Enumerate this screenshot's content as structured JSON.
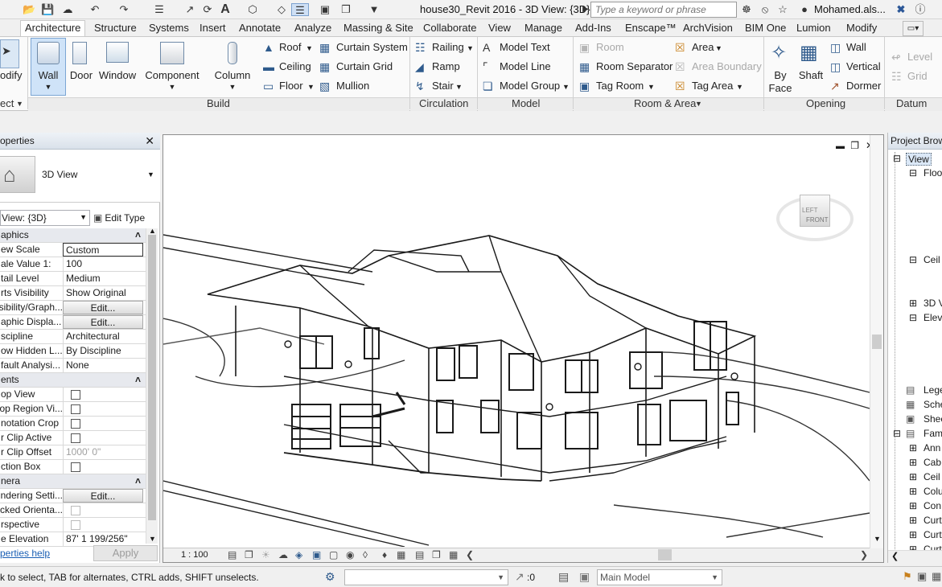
{
  "window": {
    "title": "house30_Revit 2016 - 3D View: {3D}"
  },
  "search": {
    "placeholder": "Type a keyword or phrase"
  },
  "user": {
    "name": "Mohamed.als..."
  },
  "tabs": [
    "Architecture",
    "Structure",
    "Systems",
    "Insert",
    "Annotate",
    "Analyze",
    "Massing & Site",
    "Collaborate",
    "View",
    "Manage",
    "Add-Ins",
    "Enscape™",
    "ArchVision",
    "BIM One",
    "Lumion",
    "Modify"
  ],
  "ribbon": {
    "modify": "odify",
    "select": "ect",
    "build": {
      "wall": "Wall",
      "door": "Door",
      "window": "Window",
      "component": "Component",
      "column": "Column",
      "roof": "Roof",
      "ceiling": "Ceiling",
      "floor": "Floor",
      "curtain_system": "Curtain System",
      "curtain_grid": "Curtain  Grid",
      "mullion": "Mullion",
      "panel": "Build"
    },
    "circulation": {
      "railing": "Railing",
      "ramp": "Ramp",
      "stair": "Stair",
      "panel": "Circulation"
    },
    "model": {
      "text": "Model  Text",
      "line": "Model  Line",
      "group": "Model  Group",
      "panel": "Model"
    },
    "room": {
      "room": "Room",
      "separator": "Room  Separator",
      "tag_room": "Tag  Room",
      "area": "Area",
      "area_boundary": "Area  Boundary",
      "tag_area": "Tag  Area",
      "panel": "Room & Area"
    },
    "opening": {
      "by_face": "By\nFace",
      "shaft": "Shaft",
      "wall": "Wall",
      "vertical": "Vertical",
      "dormer": "Dormer",
      "panel": "Opening"
    },
    "datum": {
      "level": "Level",
      "grid": "Grid",
      "panel": "Datum"
    }
  },
  "properties": {
    "title": "operties",
    "type_name": "3D View",
    "selector": "View: {3D}",
    "edit_type": "Edit Type",
    "rows": [
      {
        "k": "aphics",
        "group": true
      },
      {
        "k": "ew Scale",
        "v": "Custom",
        "style": "box"
      },
      {
        "k": "ale Value   1:",
        "v": "100"
      },
      {
        "k": "tail Level",
        "v": "Medium"
      },
      {
        "k": "rts Visibility",
        "v": "Show Original"
      },
      {
        "k": "sibility/Graph...",
        "v": "Edit...",
        "style": "btn"
      },
      {
        "k": "aphic Displa...",
        "v": "Edit...",
        "style": "btn"
      },
      {
        "k": "scipline",
        "v": "Architectural"
      },
      {
        "k": "ow Hidden L...",
        "v": "By Discipline"
      },
      {
        "k": "fault Analysi...",
        "v": "None"
      },
      {
        "k": "ents",
        "group": true
      },
      {
        "k": "op View",
        "cb": true
      },
      {
        "k": "op Region Vi...",
        "cb": true
      },
      {
        "k": "notation Crop",
        "cb": true
      },
      {
        "k": "r Clip Active",
        "cb": true
      },
      {
        "k": "r Clip Offset",
        "v": "1000'  0\"",
        "style": "dis"
      },
      {
        "k": "ction Box",
        "cb": true
      },
      {
        "k": "nera",
        "group": true
      },
      {
        "k": "ndering Setti...",
        "v": "Edit...",
        "style": "btn"
      },
      {
        "k": "cked Orienta...",
        "cb": true,
        "dis": true
      },
      {
        "k": "rspective",
        "cb": true,
        "dis": true
      },
      {
        "k": "e Elevation",
        "v": "87'  1 199/256\""
      }
    ],
    "help": "perties help",
    "apply": "Apply"
  },
  "viewport": {
    "scale": "1 : 100",
    "viewcube": "FRONT",
    "viewcube_side": "LEFT"
  },
  "browser": {
    "title": "Project Brow",
    "items": [
      "View",
      "Floo",
      "Ceil",
      "3D V",
      "Elev",
      "Lege",
      "Sche",
      "Shee",
      "Fam",
      "Ann",
      "Cab",
      "Ceil",
      "Colu",
      "Con",
      "Curt",
      "Curt",
      "Curt"
    ]
  },
  "status": {
    "hint": "k to select, TAB for alternates, CTRL adds, SHIFT unselects.",
    "count": ":0",
    "model": "Main Model"
  }
}
